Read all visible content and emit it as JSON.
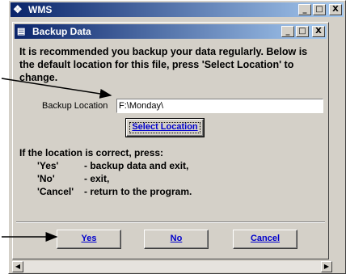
{
  "outer_window": {
    "title": "WMS",
    "minimize": "_",
    "maximize": "□",
    "close": "X"
  },
  "dialog": {
    "title": "Backup Data",
    "minimize": "_",
    "maximize": "□",
    "close": "X",
    "message": "It is recommended you backup your data regularly. Below is the default location for this file, press 'Select Location' to change.",
    "location_label": "Backup Location",
    "location_value": "F:\\Monday\\",
    "select_location_label": "Select Location",
    "instructions_header": "If the location is correct, press:",
    "instructions": [
      {
        "key": "'Yes'",
        "desc": "- backup data and exit,"
      },
      {
        "key": "'No'",
        "desc": "- exit,"
      },
      {
        "key": "'Cancel'",
        "desc": "- return to the program."
      }
    ],
    "yes_label": "Yes",
    "no_label": "No",
    "cancel_label": "Cancel"
  },
  "scrollbar": {
    "left_arrow": "◀",
    "right_arrow": "▶"
  },
  "icons": {
    "app_icon": "wms-app-icon",
    "dialog_icon": "form-icon"
  }
}
